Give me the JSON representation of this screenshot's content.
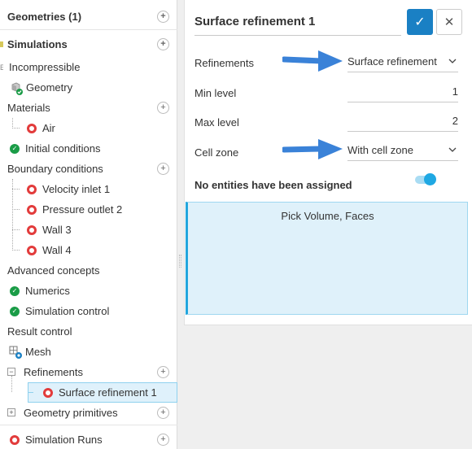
{
  "tree": {
    "geometries": "Geometries (1)",
    "simulations": "Simulations",
    "incompressible": "Incompressible",
    "geometry": "Geometry",
    "materials": "Materials",
    "air": "Air",
    "initial_conditions": "Initial conditions",
    "boundary_conditions": "Boundary conditions",
    "velocity_inlet": "Velocity inlet 1",
    "pressure_outlet": "Pressure outlet 2",
    "wall3": "Wall 3",
    "wall4": "Wall 4",
    "advanced_concepts": "Advanced concepts",
    "numerics": "Numerics",
    "simulation_control": "Simulation control",
    "result_control": "Result control",
    "mesh": "Mesh",
    "refinements": "Refinements",
    "surface_refinement": "Surface refinement 1",
    "geometry_primitives": "Geometry primitives",
    "simulation_runs": "Simulation Runs"
  },
  "panel": {
    "title": "Surface refinement 1",
    "refinements_label": "Refinements",
    "refinements_value": "Surface refinement",
    "min_level_label": "Min level",
    "min_level_value": "1",
    "max_level_label": "Max level",
    "max_level_value": "2",
    "cell_zone_label": "Cell zone",
    "cell_zone_value": "With cell zone",
    "no_entities": "No entities have been assigned",
    "toggle_on": true,
    "pick_text": "Pick Volume, Faces"
  },
  "icons": {
    "plus": "+",
    "minus": "−",
    "check": "✓",
    "close": "✕",
    "caret": "⌵"
  },
  "colors": {
    "accent": "#1a80c4",
    "selection": "#dff1fb",
    "error_ring": "#e23b3b",
    "ok_check": "#1a9c47",
    "annotation_arrow": "#3a82d8"
  }
}
